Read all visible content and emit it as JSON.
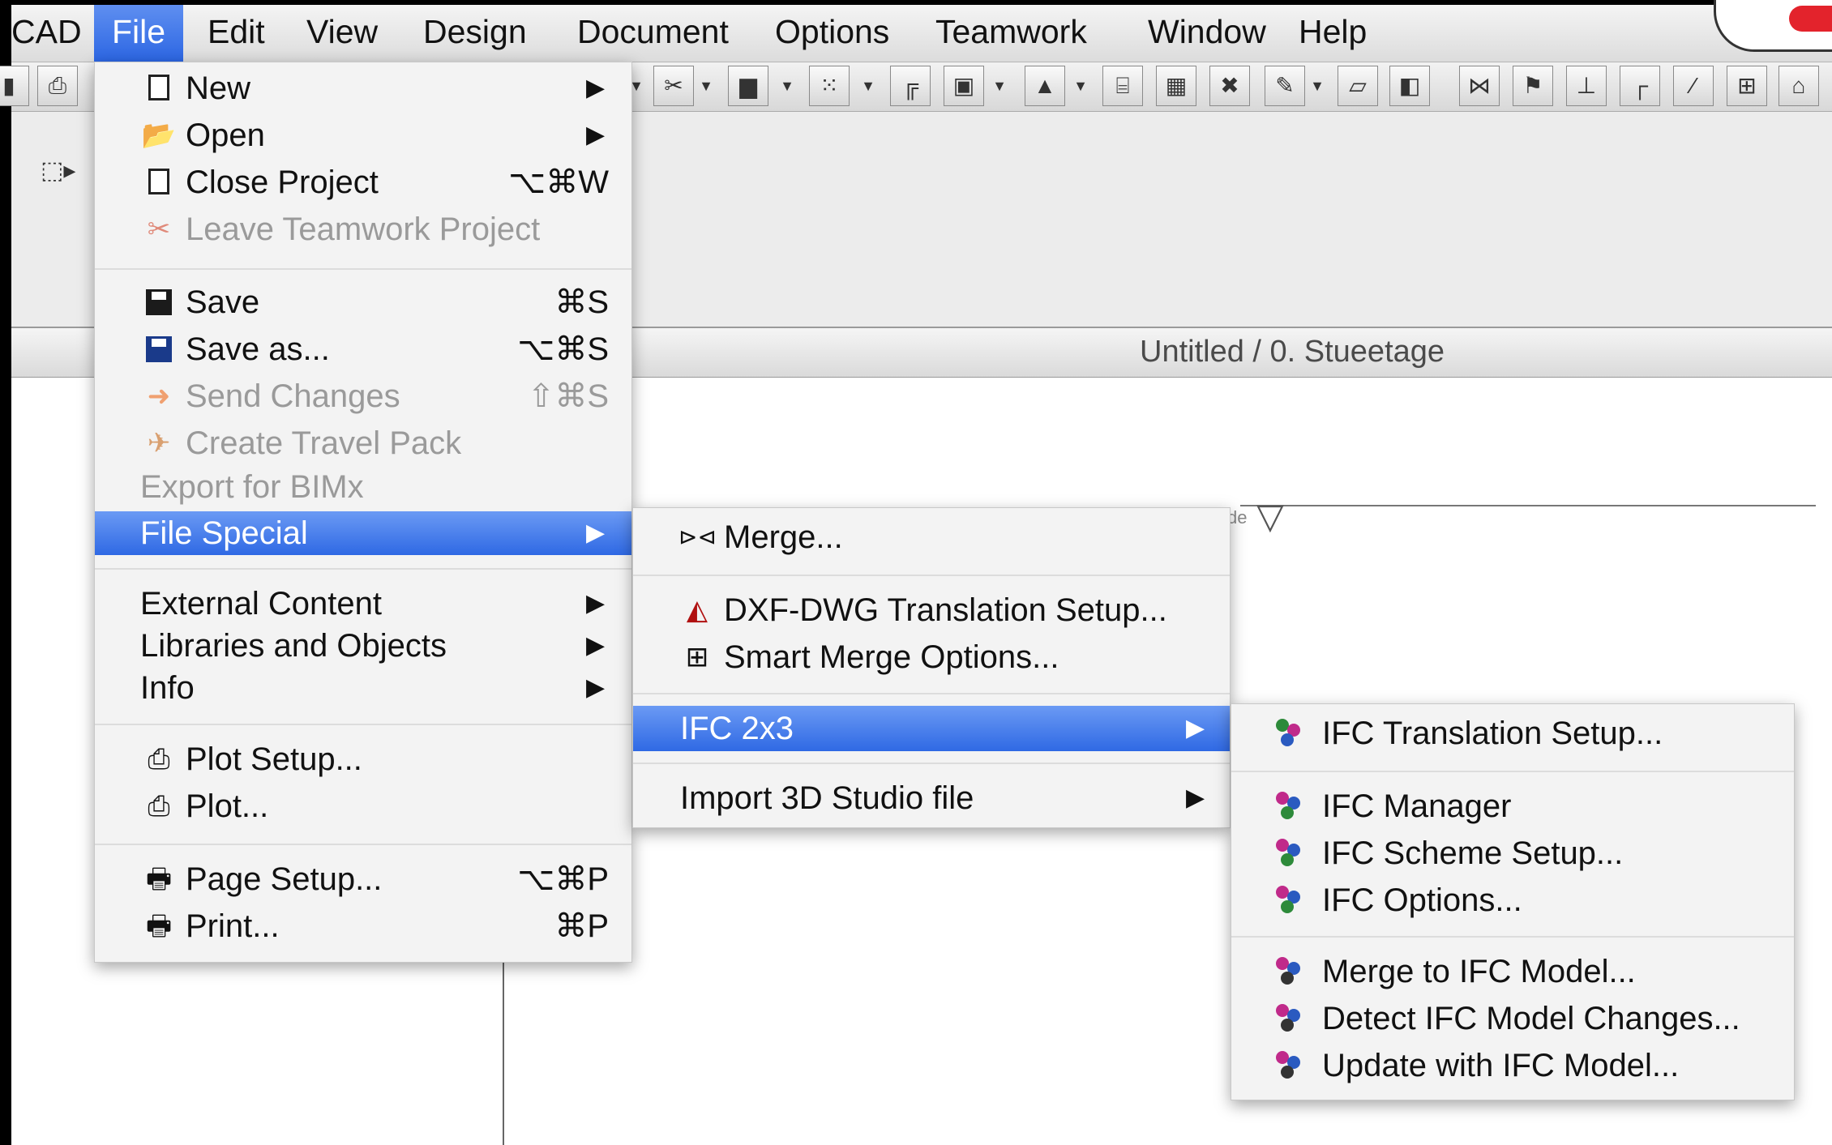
{
  "menubar": {
    "app_name": "CAD",
    "items": [
      "File",
      "Edit",
      "View",
      "Design",
      "Document",
      "Options",
      "Teamwork",
      "Window",
      "Help"
    ]
  },
  "document": {
    "title": "Untitled / 0. Stueetage"
  },
  "file_menu": {
    "new": "New",
    "open": "Open",
    "close_project": "Close Project",
    "close_project_shortcut": "⌥⌘W",
    "leave_teamwork": "Leave Teamwork Project",
    "save": "Save",
    "save_shortcut": "⌘S",
    "save_as": "Save as...",
    "save_as_shortcut": "⌥⌘S",
    "send_changes": "Send Changes",
    "send_changes_shortcut": "⇧⌘S",
    "create_travel_pack": "Create Travel Pack",
    "export_bimx": "Export for BIMx",
    "file_special": "File Special",
    "external_content": "External Content",
    "libraries_objects": "Libraries and Objects",
    "info": "Info",
    "plot_setup": "Plot Setup...",
    "plot": "Plot...",
    "page_setup": "Page Setup...",
    "page_setup_shortcut": "⌥⌘P",
    "print": "Print...",
    "print_shortcut": "⌘P"
  },
  "file_special_menu": {
    "merge": "Merge...",
    "dxf_dwg": "DXF-DWG Translation Setup...",
    "smart_merge": "Smart Merge Options...",
    "ifc_2x3": "IFC 2x3",
    "import_3ds": "Import 3D Studio file"
  },
  "ifc_menu": {
    "translation_setup": "IFC Translation Setup...",
    "manager": "IFC Manager",
    "scheme_setup": "IFC Scheme Setup...",
    "options": "IFC Options...",
    "merge_model": "Merge to IFC Model...",
    "detect_changes": "Detect IFC Model Changes...",
    "update_model": "Update with IFC Model..."
  },
  "icons": {
    "submenu_arrow": "▶",
    "print": "🖶",
    "open_folder": "📂"
  },
  "colors": {
    "highlight": "#2f69e4",
    "menu_bg": "#f3f3f3",
    "disabled_text": "#9a9a9a"
  }
}
